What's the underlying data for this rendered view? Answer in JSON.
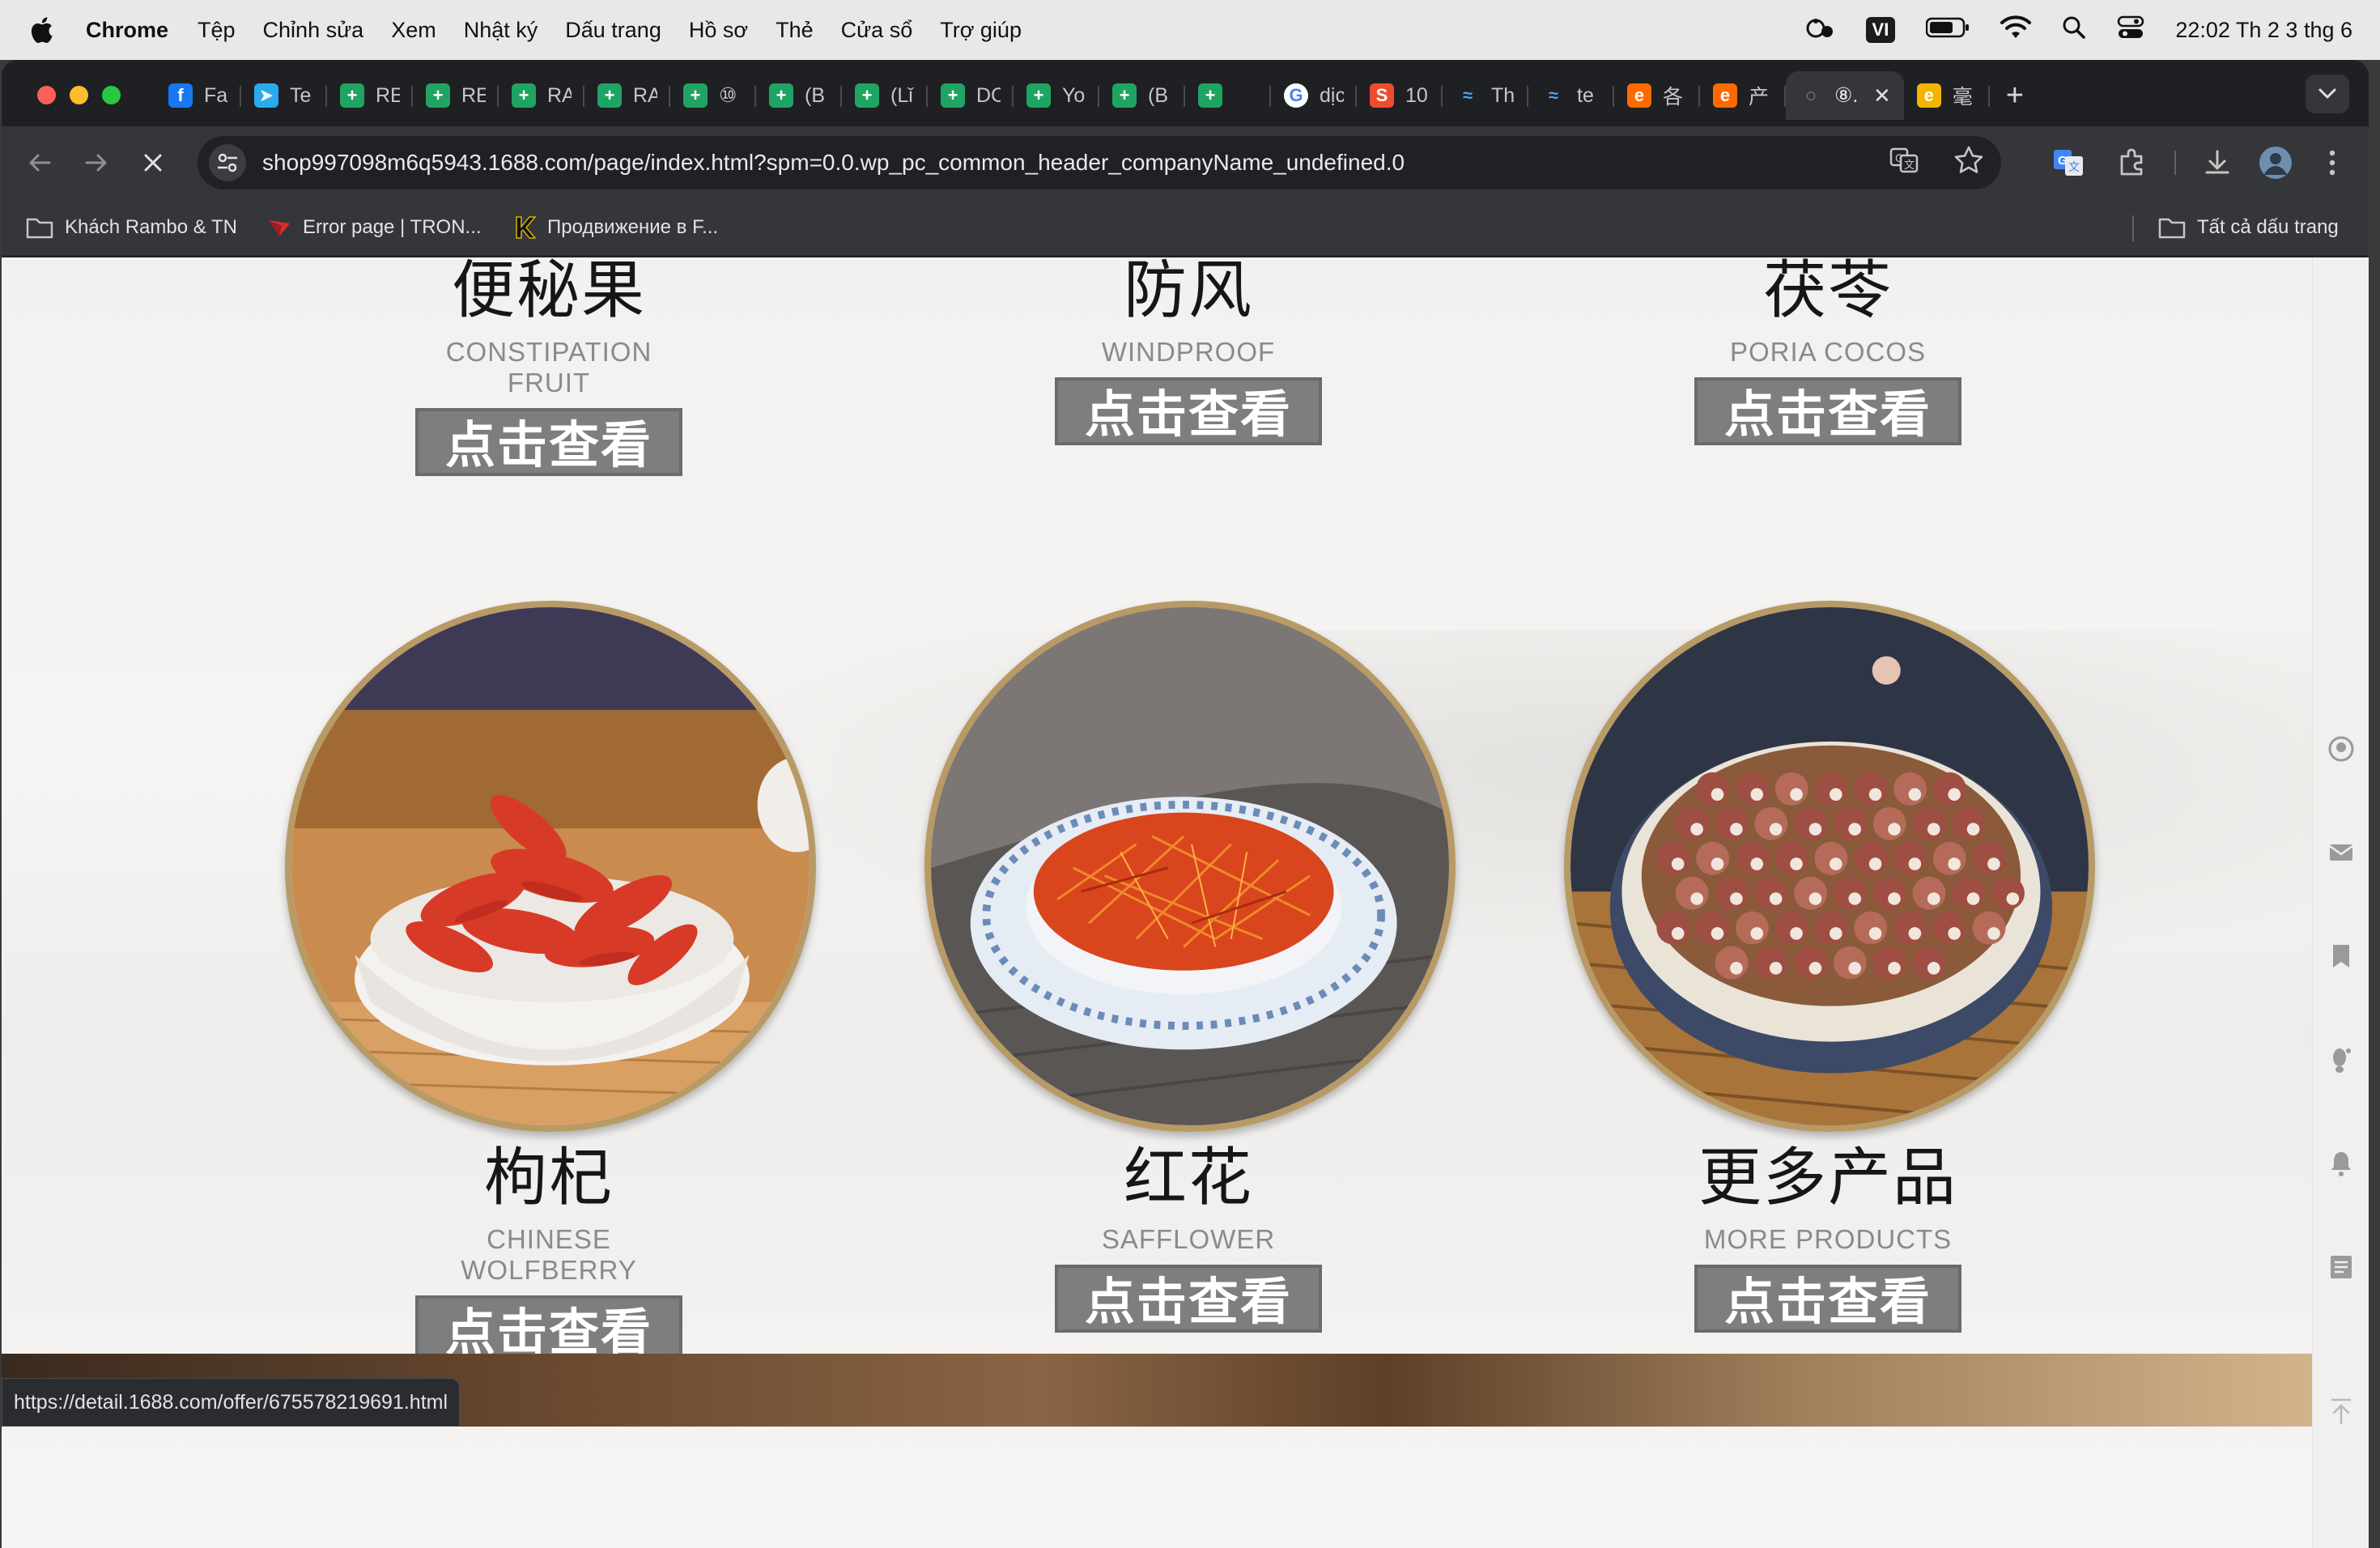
{
  "menubar": {
    "app": "Chrome",
    "items": [
      "Tệp",
      "Chỉnh sửa",
      "Xem",
      "Nhật ký",
      "Dấu trang",
      "Hồ sơ",
      "Thẻ",
      "Cửa sổ",
      "Trợ giúp"
    ],
    "input_source": "VI",
    "clock": "22:02 Th 2 3 thg 6"
  },
  "tabs": [
    {
      "label": "Fa",
      "icon": "facebook-icon",
      "color": "#1877f2",
      "glyph": "f"
    },
    {
      "label": "Te",
      "icon": "telegram-icon",
      "color": "#2aabee",
      "glyph": "➤"
    },
    {
      "label": "RE",
      "icon": "sheets-icon",
      "color": "#1fa463",
      "glyph": "+"
    },
    {
      "label": "RE",
      "icon": "sheets-icon",
      "color": "#1fa463",
      "glyph": "+"
    },
    {
      "label": "RA",
      "icon": "sheets-icon",
      "color": "#1fa463",
      "glyph": "+"
    },
    {
      "label": "RA",
      "icon": "sheets-icon",
      "color": "#1fa463",
      "glyph": "+"
    },
    {
      "label": "⑩",
      "icon": "sheets-icon",
      "color": "#1fa463",
      "glyph": "+"
    },
    {
      "label": "(B",
      "icon": "sheets-icon",
      "color": "#1fa463",
      "glyph": "+"
    },
    {
      "label": "(Lǐ",
      "icon": "sheets-icon",
      "color": "#1fa463",
      "glyph": "+"
    },
    {
      "label": "DC",
      "icon": "sheets-icon",
      "color": "#1fa463",
      "glyph": "+"
    },
    {
      "label": "Yo",
      "icon": "sheets-icon",
      "color": "#1fa463",
      "glyph": "+"
    },
    {
      "label": "(B",
      "icon": "sheets-icon",
      "color": "#1fa463",
      "glyph": "+"
    },
    {
      "label": "",
      "icon": "sheets-icon",
      "color": "#1fa463",
      "glyph": "+"
    },
    {
      "label": "dịc",
      "icon": "google-icon",
      "color": "#ffffff",
      "glyph": "G"
    },
    {
      "label": "10",
      "icon": "shopee-icon",
      "color": "#ee4d2d",
      "glyph": "S"
    },
    {
      "label": "Th",
      "icon": "lens-icon",
      "color": "#2d8cf0",
      "glyph": "≈"
    },
    {
      "label": "te",
      "icon": "lens-icon",
      "color": "#2d8cf0",
      "glyph": "≈"
    },
    {
      "label": "各",
      "icon": "1688-icon",
      "color": "#ff6a00",
      "glyph": "e"
    },
    {
      "label": "产",
      "icon": "1688-icon",
      "color": "#ff6a00",
      "glyph": "e"
    },
    {
      "label": "⑧.",
      "icon": "loading-icon",
      "color": "#5f6368",
      "glyph": "◌",
      "active": true
    },
    {
      "label": "毫",
      "icon": "shop-icon",
      "color": "#f5b400",
      "glyph": "e"
    }
  ],
  "toolbar": {
    "url": "shop997098m6q5943.1688.com/page/index.html?spm=0.0.wp_pc_common_header_companyName_undefined.0"
  },
  "bookmarks": {
    "items": [
      "Khách Rambo & TN",
      "Error page | TRON...",
      "Продвижение в F..."
    ],
    "all": "Tất cả dấu trang"
  },
  "products": [
    {
      "cn": "便秘果",
      "en": "CONSTIPATION FRUIT",
      "button": "点击查看"
    },
    {
      "cn": "防风",
      "en": "WINDPROOF",
      "button": "点击查看"
    },
    {
      "cn": "茯苓",
      "en": "PORIA COCOS",
      "button": "点击查看"
    },
    {
      "cn": "枸杞",
      "en": "CHINESE WOLFBERRY",
      "button": "点击查看"
    },
    {
      "cn": "红花",
      "en": "SAFFLOWER",
      "button": "点击查看"
    },
    {
      "cn": "更多产品",
      "en": "MORE PRODUCTS",
      "button": "点击查看"
    }
  ],
  "status_url": "https://detail.1688.com/offer/675578219691.html",
  "colors": {
    "button_bg": "#7e7e7e",
    "circle_border": "#b79a66",
    "chrome_toolbar": "#35363a"
  }
}
